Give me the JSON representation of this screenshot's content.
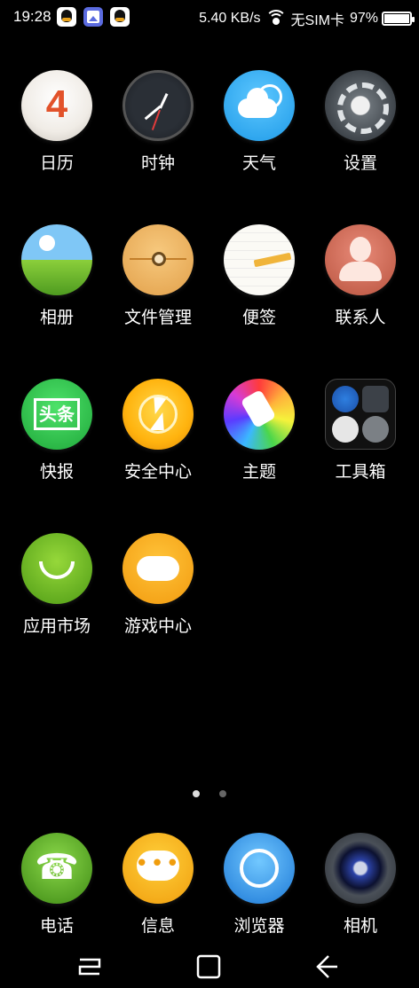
{
  "status_bar": {
    "time": "19:28",
    "notifications": [
      "qq-icon",
      "gallery-icon",
      "qq-icon"
    ],
    "speed": "5.40 KB/s",
    "sim": "无SIM卡",
    "battery": "97%"
  },
  "apps": [
    {
      "label": "日历",
      "icon": "calendar-icon",
      "number": "4"
    },
    {
      "label": "时钟",
      "icon": "clock-icon"
    },
    {
      "label": "天气",
      "icon": "weather-icon"
    },
    {
      "label": "设置",
      "icon": "settings-gear-icon"
    },
    {
      "label": "相册",
      "icon": "album-icon"
    },
    {
      "label": "文件管理",
      "icon": "file-manager-icon"
    },
    {
      "label": "便签",
      "icon": "notes-icon"
    },
    {
      "label": "联系人",
      "icon": "contacts-icon"
    },
    {
      "label": "快报",
      "icon": "news-icon",
      "badge": "头条"
    },
    {
      "label": "安全中心",
      "icon": "security-bolt-icon"
    },
    {
      "label": "主题",
      "icon": "theme-brush-icon"
    },
    {
      "label": "工具箱",
      "icon": "toolbox-folder-icon"
    },
    {
      "label": "应用市场",
      "icon": "app-store-icon"
    },
    {
      "label": "游戏中心",
      "icon": "game-controller-icon"
    }
  ],
  "pager": {
    "pages": 2,
    "current": 1
  },
  "dock": [
    {
      "label": "电话",
      "icon": "phone-icon"
    },
    {
      "label": "信息",
      "icon": "messages-icon"
    },
    {
      "label": "浏览器",
      "icon": "browser-icon"
    },
    {
      "label": "相机",
      "icon": "camera-icon"
    }
  ],
  "nav_bar": [
    "recents-icon",
    "home-icon",
    "back-icon"
  ]
}
